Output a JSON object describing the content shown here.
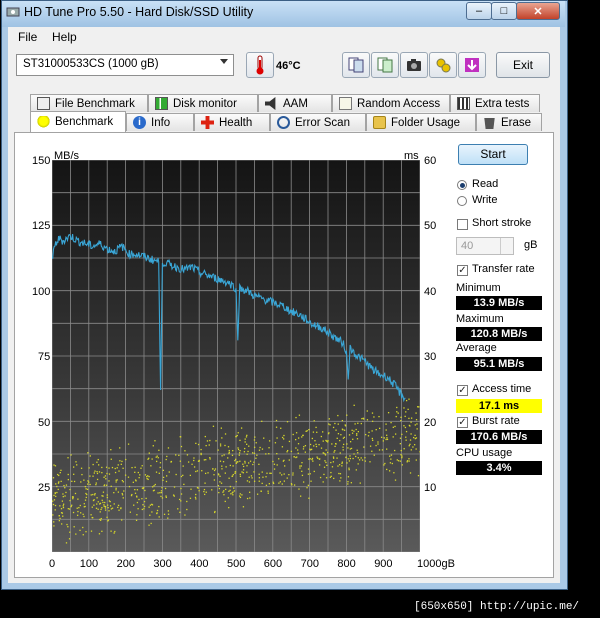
{
  "window": {
    "title": "HD Tune Pro 5.50 - Hard Disk/SSD Utility",
    "min": "–",
    "max": "□",
    "close": "✕"
  },
  "menu": {
    "file": "File",
    "help": "Help"
  },
  "toolbar": {
    "drive": "ST31000533CS (1000 gB)",
    "temperature": "46°C",
    "exit": "Exit"
  },
  "tabs_top": [
    "File Benchmark",
    "Disk monitor",
    "AAM",
    "Random Access",
    "Extra tests"
  ],
  "tabs_bottom": [
    "Benchmark",
    "Info",
    "Health",
    "Error Scan",
    "Folder Usage",
    "Erase"
  ],
  "side": {
    "start": "Start",
    "read": "Read",
    "write": "Write",
    "short_stroke": "Short stroke",
    "stroke_value": "40",
    "stroke_unit": "gB",
    "transfer_rate": "Transfer rate",
    "minimum_label": "Minimum",
    "minimum": "13.9 MB/s",
    "maximum_label": "Maximum",
    "maximum": "120.8 MB/s",
    "average_label": "Average",
    "average": "95.1 MB/s",
    "access_time": "Access time",
    "access_value": "17.1 ms",
    "burst_rate": "Burst rate",
    "burst_value": "170.6 MB/s",
    "cpu_label": "CPU usage",
    "cpu_value": "3.4%"
  },
  "footer": "[650x650] http://upic.me/",
  "chart_data": {
    "type": "line",
    "ylabel": "MB/s",
    "y2label": "ms",
    "xlabel_unit": "gB",
    "ylim": [
      0,
      150
    ],
    "y2lim": [
      0,
      60
    ],
    "xlim": [
      0,
      1000
    ],
    "yticks": [
      "150",
      "125",
      "100",
      "75",
      "50",
      "25"
    ],
    "y2ticks": [
      "60",
      "50",
      "40",
      "30",
      "20",
      "10"
    ],
    "xticks": [
      "0",
      "100",
      "200",
      "300",
      "400",
      "500",
      "600",
      "700",
      "800",
      "900",
      "1000gB"
    ],
    "series": [
      {
        "values": [
          [
            0,
            112
          ],
          [
            10,
            118
          ],
          [
            20,
            120
          ],
          [
            30,
            119
          ],
          [
            50,
            121
          ],
          [
            70,
            119
          ],
          [
            90,
            118
          ],
          [
            110,
            117
          ],
          [
            130,
            118
          ],
          [
            150,
            116
          ],
          [
            170,
            115
          ],
          [
            190,
            117
          ],
          [
            210,
            114
          ],
          [
            230,
            114
          ],
          [
            250,
            113
          ],
          [
            270,
            112
          ],
          [
            290,
            111
          ],
          [
            295,
            62
          ],
          [
            300,
            111
          ],
          [
            320,
            110
          ],
          [
            340,
            109
          ],
          [
            360,
            108
          ],
          [
            380,
            109
          ],
          [
            400,
            107
          ],
          [
            420,
            106
          ],
          [
            440,
            105
          ],
          [
            460,
            104
          ],
          [
            480,
            103
          ],
          [
            500,
            101
          ],
          [
            505,
            81
          ],
          [
            510,
            101
          ],
          [
            530,
            100
          ],
          [
            550,
            98
          ],
          [
            570,
            97
          ],
          [
            590,
            96
          ],
          [
            610,
            95
          ],
          [
            630,
            94
          ],
          [
            650,
            92
          ],
          [
            670,
            91
          ],
          [
            690,
            89
          ],
          [
            710,
            87
          ],
          [
            730,
            86
          ],
          [
            750,
            84
          ],
          [
            770,
            82
          ],
          [
            790,
            80
          ],
          [
            800,
            77
          ],
          [
            805,
            66
          ],
          [
            810,
            78
          ],
          [
            830,
            75
          ],
          [
            850,
            73
          ],
          [
            870,
            70
          ],
          [
            890,
            68
          ],
          [
            910,
            67
          ],
          [
            930,
            64
          ],
          [
            950,
            60
          ],
          [
            960,
            59
          ]
        ]
      }
    ],
    "scatter_note": "",
    "grid": true
  }
}
